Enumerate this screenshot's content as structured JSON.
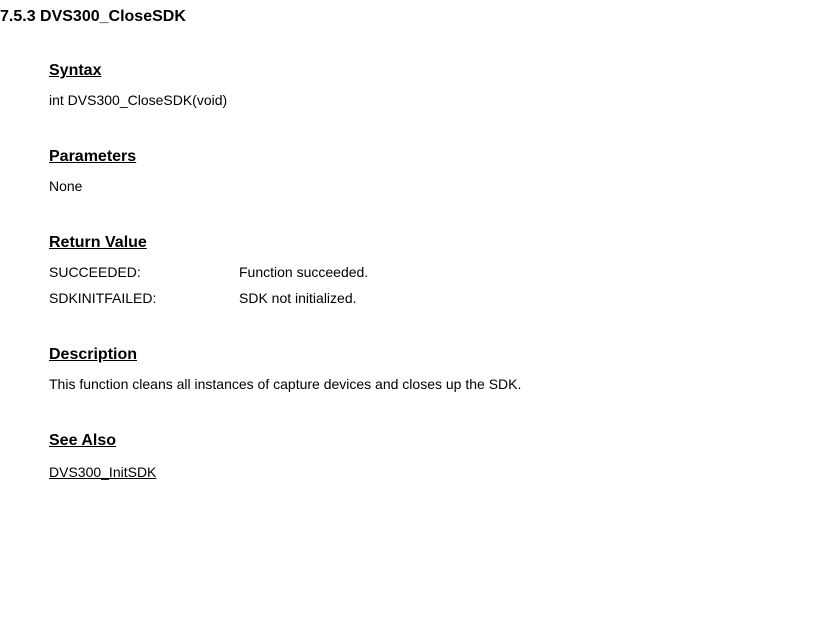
{
  "title": "7.5.3 DVS300_CloseSDK",
  "syntax": {
    "heading": "Syntax",
    "text": "int DVS300_CloseSDK(void)"
  },
  "parameters": {
    "heading": "Parameters",
    "text": "None"
  },
  "returnValue": {
    "heading": "Return Value",
    "rows": [
      {
        "label": "SUCCEEDED:",
        "desc": "Function succeeded."
      },
      {
        "label": "SDKINITFAILED:",
        "desc": "SDK not initialized."
      }
    ]
  },
  "description": {
    "heading": "Description",
    "text": "This function cleans all instances of capture devices and closes up the SDK."
  },
  "seeAlso": {
    "heading": "See Also",
    "link": "DVS300_InitSDK"
  }
}
